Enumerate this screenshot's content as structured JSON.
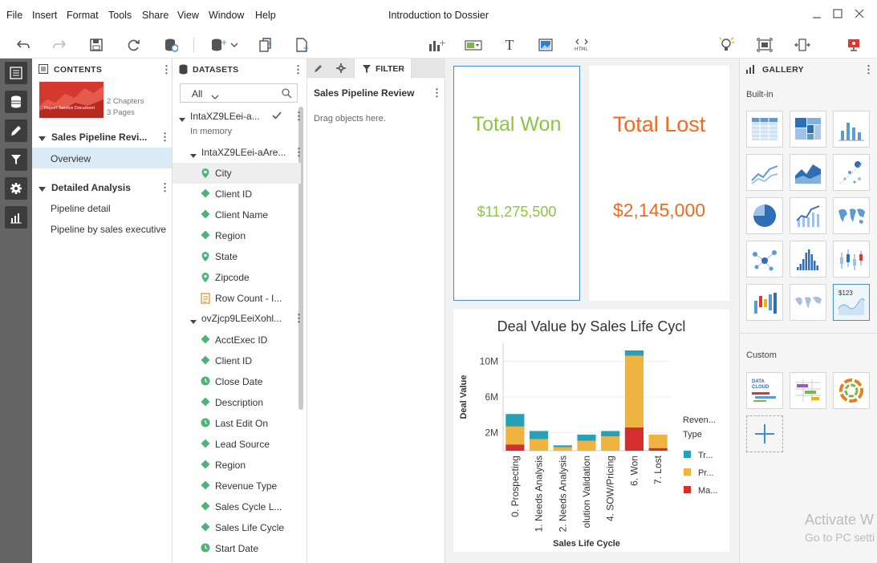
{
  "menu": [
    "File",
    "Insert",
    "Format",
    "Tools",
    "Share",
    "View",
    "Window",
    "Help"
  ],
  "window_title": "Introduction to Dossier",
  "contents": {
    "header": "CONTENTS",
    "thumb_label": "Report Service Document",
    "chapters": "2 Chapters",
    "pages": "3 Pages",
    "chapter1": {
      "title": "Sales Pipeline Revi...",
      "pages": [
        "Overview"
      ]
    },
    "chapter2": {
      "title": "Detailed Analysis",
      "pages": [
        "Pipeline detail",
        "Pipeline by sales executive"
      ]
    }
  },
  "datasets": {
    "header": "DATASETS",
    "filter_value": "All",
    "ds1": {
      "name": "IntaXZ9LEei-a...",
      "status": "In memory",
      "table": "IntaXZ9LEei-aAre...",
      "items": [
        "City",
        "Client ID",
        "Client Name",
        "Region",
        "State",
        "Zipcode",
        "Row Count - I..."
      ]
    },
    "ds2": {
      "name": "ovZjcp9LEeiXohl...",
      "items": [
        "AcctExec ID",
        "Client ID",
        "Close Date",
        "Description",
        "Last Edit On",
        "Lead Source",
        "Region",
        "Revenue Type",
        "Sales Cycle L...",
        "Sales Life Cycle",
        "Start Date"
      ]
    }
  },
  "filter": {
    "tab_label": "FILTER",
    "title": "Sales Pipeline Review",
    "hint": "Drag objects here."
  },
  "kpis": [
    {
      "label": "Total Won",
      "value": "$11,275,500",
      "color": "#8cc63f"
    },
    {
      "label": "Total Lost",
      "value": "$2,145,000",
      "color": "#f06a22"
    }
  ],
  "gallery": {
    "header": "GALLERY",
    "builtin": "Built-in",
    "custom": "Custom",
    "tile_text": "$123",
    "data_cloud": "DATA CLOUD"
  },
  "watermark": {
    "line1": "Activate W",
    "line2": "Go to PC setti"
  },
  "chart_data": {
    "type": "bar",
    "title": "Deal Value by Sales Life Cycl",
    "xlabel": "Sales Life Cycle",
    "ylabel": "Deal Value",
    "ylim": [
      0,
      12000000
    ],
    "ticks": [
      {
        "v": 2000000,
        "label": "2M"
      },
      {
        "v": 6000000,
        "label": "6M"
      },
      {
        "v": 10000000,
        "label": "10M"
      }
    ],
    "categories": [
      "0. Prospecting",
      "1. Needs Analysis",
      "2. Needs Analysis",
      "olution Validation",
      "4. SOW/Pricing",
      "6. Won",
      "7. Lost"
    ],
    "legend_title": [
      "Reven...",
      "Type"
    ],
    "series": [
      {
        "name": "Tr...",
        "color": "#2aa0b6",
        "values": [
          1400000,
          900000,
          200000,
          700000,
          600000,
          600000,
          0
        ]
      },
      {
        "name": "Pr...",
        "color": "#efb33f",
        "values": [
          2000000,
          1300000,
          400000,
          1100000,
          1600000,
          8000000,
          1500000
        ]
      },
      {
        "name": "Ma...",
        "color": "#d32f2f",
        "values": [
          700000,
          0,
          0,
          0,
          0,
          2600000,
          300000
        ]
      }
    ]
  }
}
